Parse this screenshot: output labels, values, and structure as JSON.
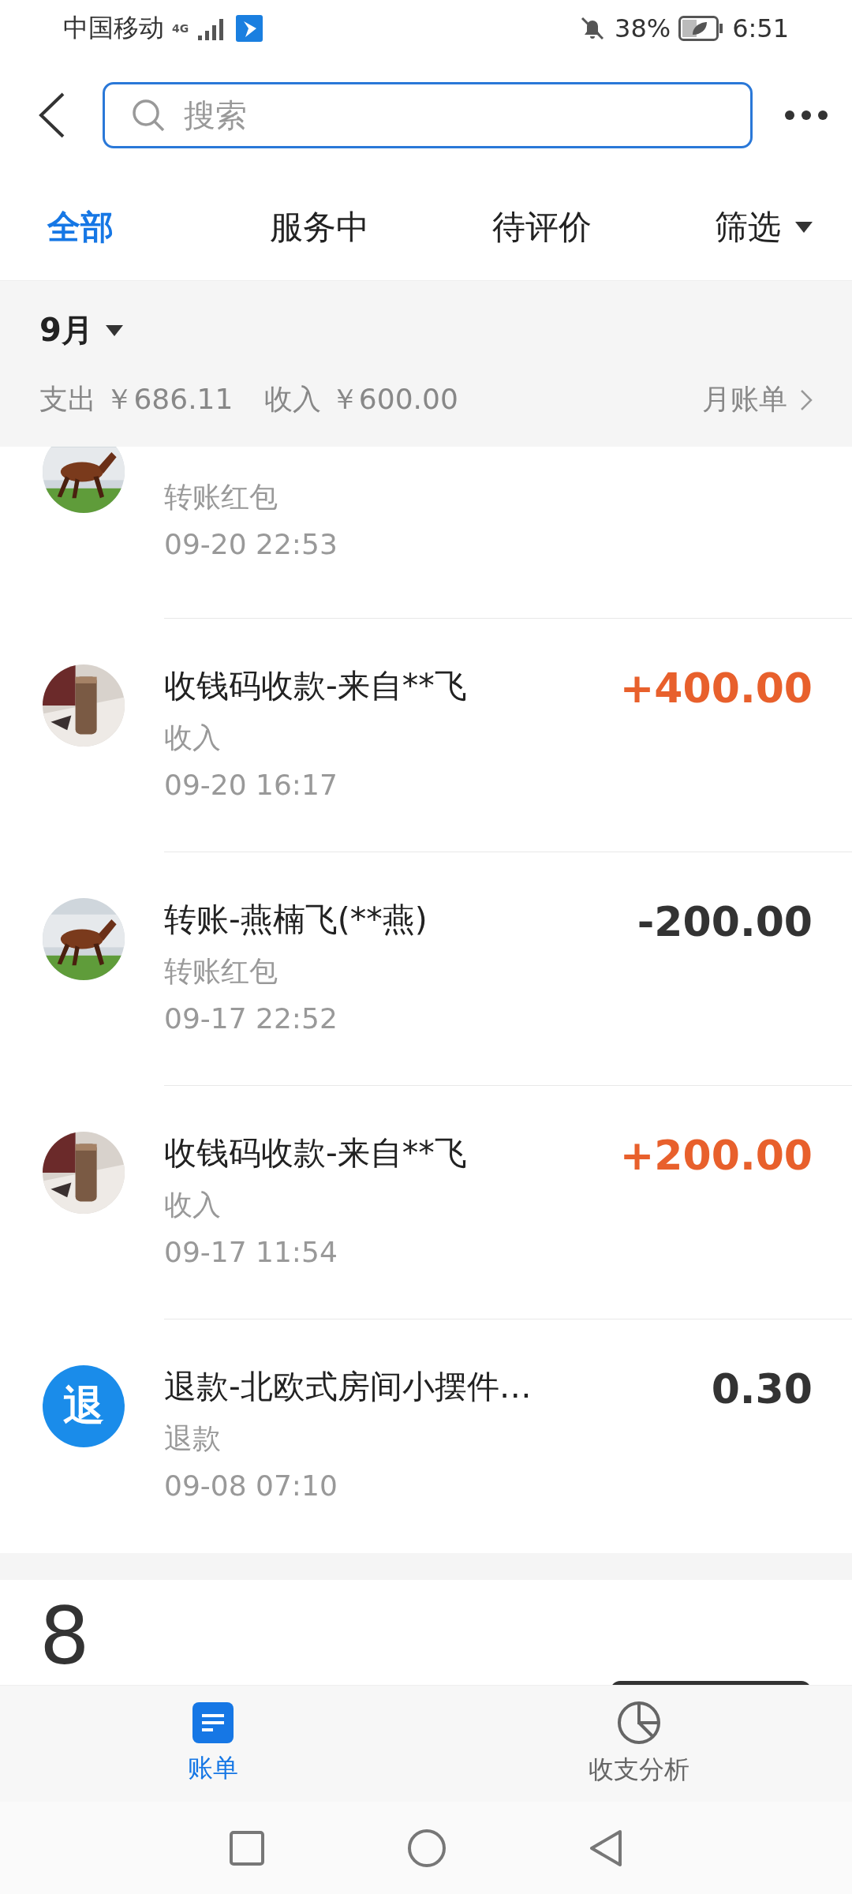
{
  "status_bar": {
    "carrier": "中国移动",
    "network": "4G",
    "battery": "38%",
    "time": "6:51"
  },
  "search": {
    "placeholder": "搜索"
  },
  "tabs": [
    {
      "label": "全部",
      "selected": true
    },
    {
      "label": "服务中",
      "selected": false
    },
    {
      "label": "待评价",
      "selected": false
    }
  ],
  "filter": {
    "label": "筛选"
  },
  "summary": {
    "month": "9月",
    "expense": "支出 ￥686.11",
    "income": "收入 ￥600.00",
    "link": "月账单"
  },
  "transactions": [
    {
      "avatar": {
        "kind": "horse"
      },
      "category": "转账红包",
      "time": "09-20  22:53"
    },
    {
      "avatar": {
        "kind": "object"
      },
      "title": "收钱码收款-来自**飞",
      "category": "收入",
      "time": "09-20  16:17",
      "amount": "+400.00",
      "color": "#e8602c"
    },
    {
      "avatar": {
        "kind": "horse"
      },
      "title": "转账-燕楠飞(**燕)",
      "category": "转账红包",
      "time": "09-17  22:52",
      "amount": "-200.00",
      "color": "#333333"
    },
    {
      "avatar": {
        "kind": "object"
      },
      "title": "收钱码收款-来自**飞",
      "category": "收入",
      "time": "09-17  11:54",
      "amount": "+200.00",
      "color": "#e8602c"
    },
    {
      "avatar": {
        "kind": "badge",
        "text": "退"
      },
      "title": "退款-北欧式房间小摆件…",
      "category": "退款",
      "time": "09-08  07:10",
      "amount": "0.30",
      "color": "#333333"
    }
  ],
  "next_month": {
    "number": "8"
  },
  "bottom_tabs": [
    {
      "label": "账单",
      "selected": true,
      "kind": "bill"
    },
    {
      "label": "收支分析",
      "selected": false,
      "kind": "chart"
    }
  ]
}
